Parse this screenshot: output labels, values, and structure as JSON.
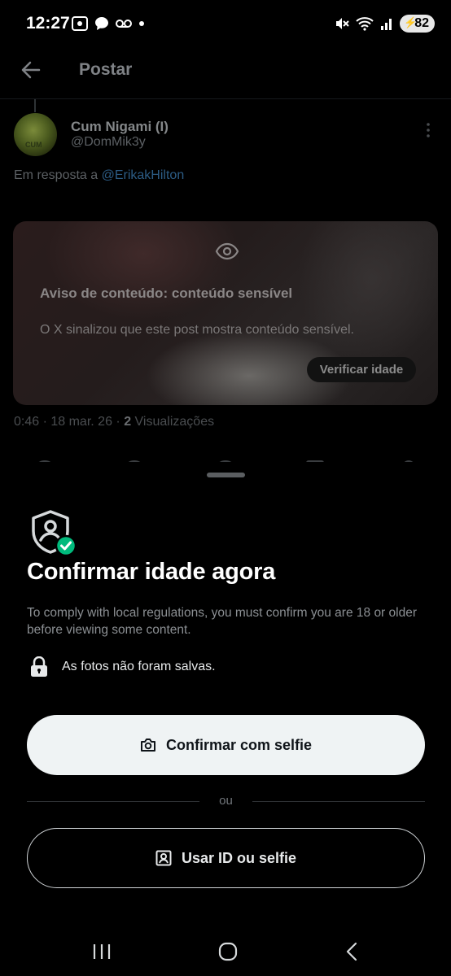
{
  "status_bar": {
    "time": "12:27",
    "battery": "82"
  },
  "header": {
    "title": "Postar"
  },
  "post": {
    "author_name": "Cum Nigami (I)",
    "author_handle": "@DomMik3y",
    "avatar_text": "CUM",
    "reply_prefix": "Em resposta a",
    "reply_mention": "@ErikakHilton",
    "warning_title": "Aviso de conteúdo: conteúdo sensível",
    "warning_body": "O X sinalizou que este post mostra conteúdo sensível.",
    "verify_button": "Verificar idade",
    "meta_time": "0:46 · 18 mar. 26 ·",
    "meta_views_count": "2",
    "meta_views_label": "Visualizações"
  },
  "sheet": {
    "title": "Confirmar idade agora",
    "description": "To comply with local regulations, you must confirm you are 18 or older before viewing some content.",
    "privacy_note": "As fotos não foram salvas.",
    "primary_button": "Confirmar com selfie",
    "divider_text": "ou",
    "secondary_button": "Usar ID ou selfie"
  },
  "colors": {
    "accent_green": "#00ba7c",
    "link_blue": "#1d9bf0",
    "background": "#000000"
  }
}
